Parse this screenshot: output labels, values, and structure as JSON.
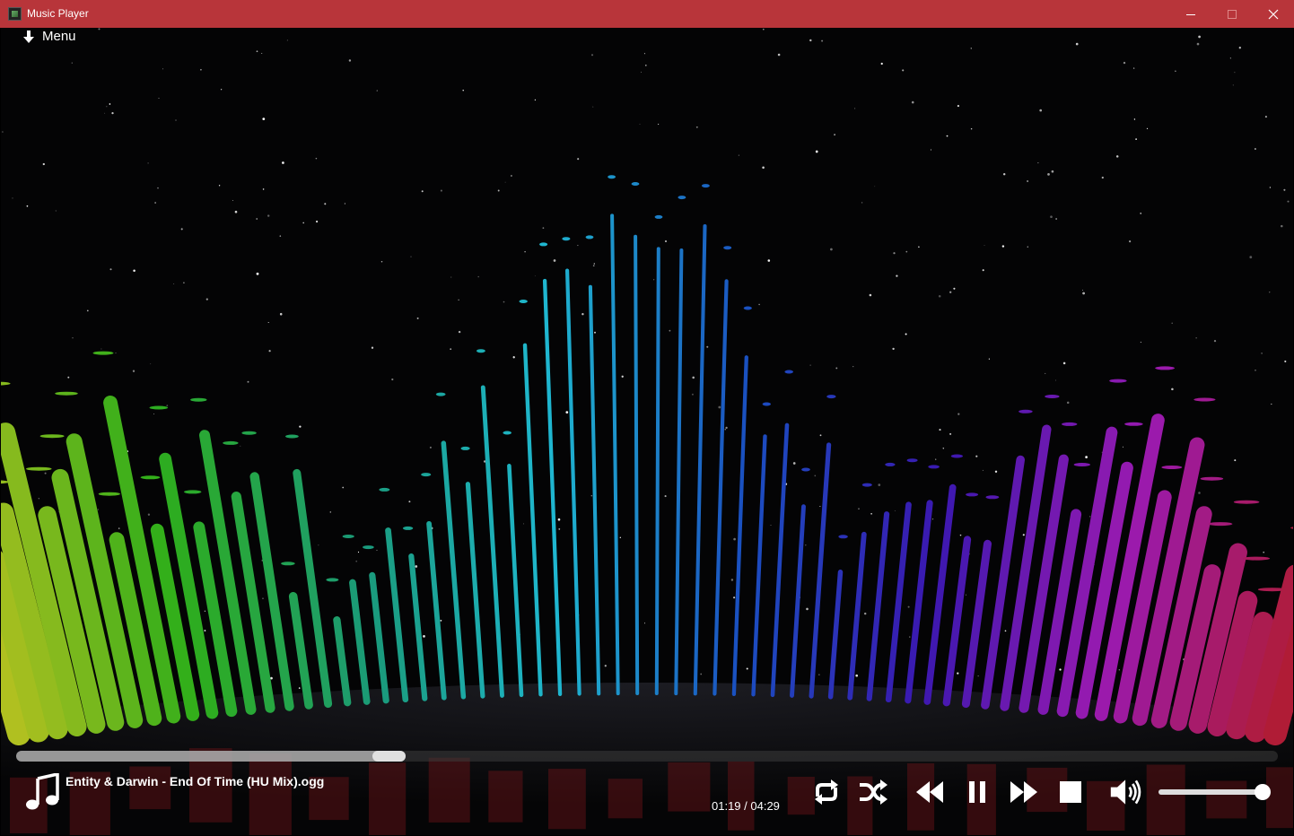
{
  "window": {
    "title": "Music Player",
    "titlebar_color": "#b8353a"
  },
  "menu": {
    "label": "Menu",
    "icon": "arrow-down-icon"
  },
  "player": {
    "track_name": "Entity & Darwin - End Of Time (HU Mix).ogg",
    "time_display": "01:19 / 04:29",
    "progress_fraction": 0.29,
    "volume_fraction": 1.0,
    "is_playing": true
  },
  "controls": [
    {
      "name": "repeat-button",
      "icon": "repeat-icon"
    },
    {
      "name": "shuffle-button",
      "icon": "shuffle-icon"
    },
    {
      "name": "previous-button",
      "icon": "rewind-icon"
    },
    {
      "name": "pause-button",
      "icon": "pause-icon"
    },
    {
      "name": "next-button",
      "icon": "fast-forward-icon"
    },
    {
      "name": "stop-button",
      "icon": "stop-icon"
    },
    {
      "name": "volume-button",
      "icon": "volume-icon"
    }
  ],
  "visualizer": {
    "type": "3D spectrum bars",
    "colors": [
      "#b0c020",
      "#2fae1a",
      "#1a9a7a",
      "#1fb8d0",
      "#1a4fc0",
      "#3a18b0",
      "#9a1ab0",
      "#b01c36"
    ]
  }
}
